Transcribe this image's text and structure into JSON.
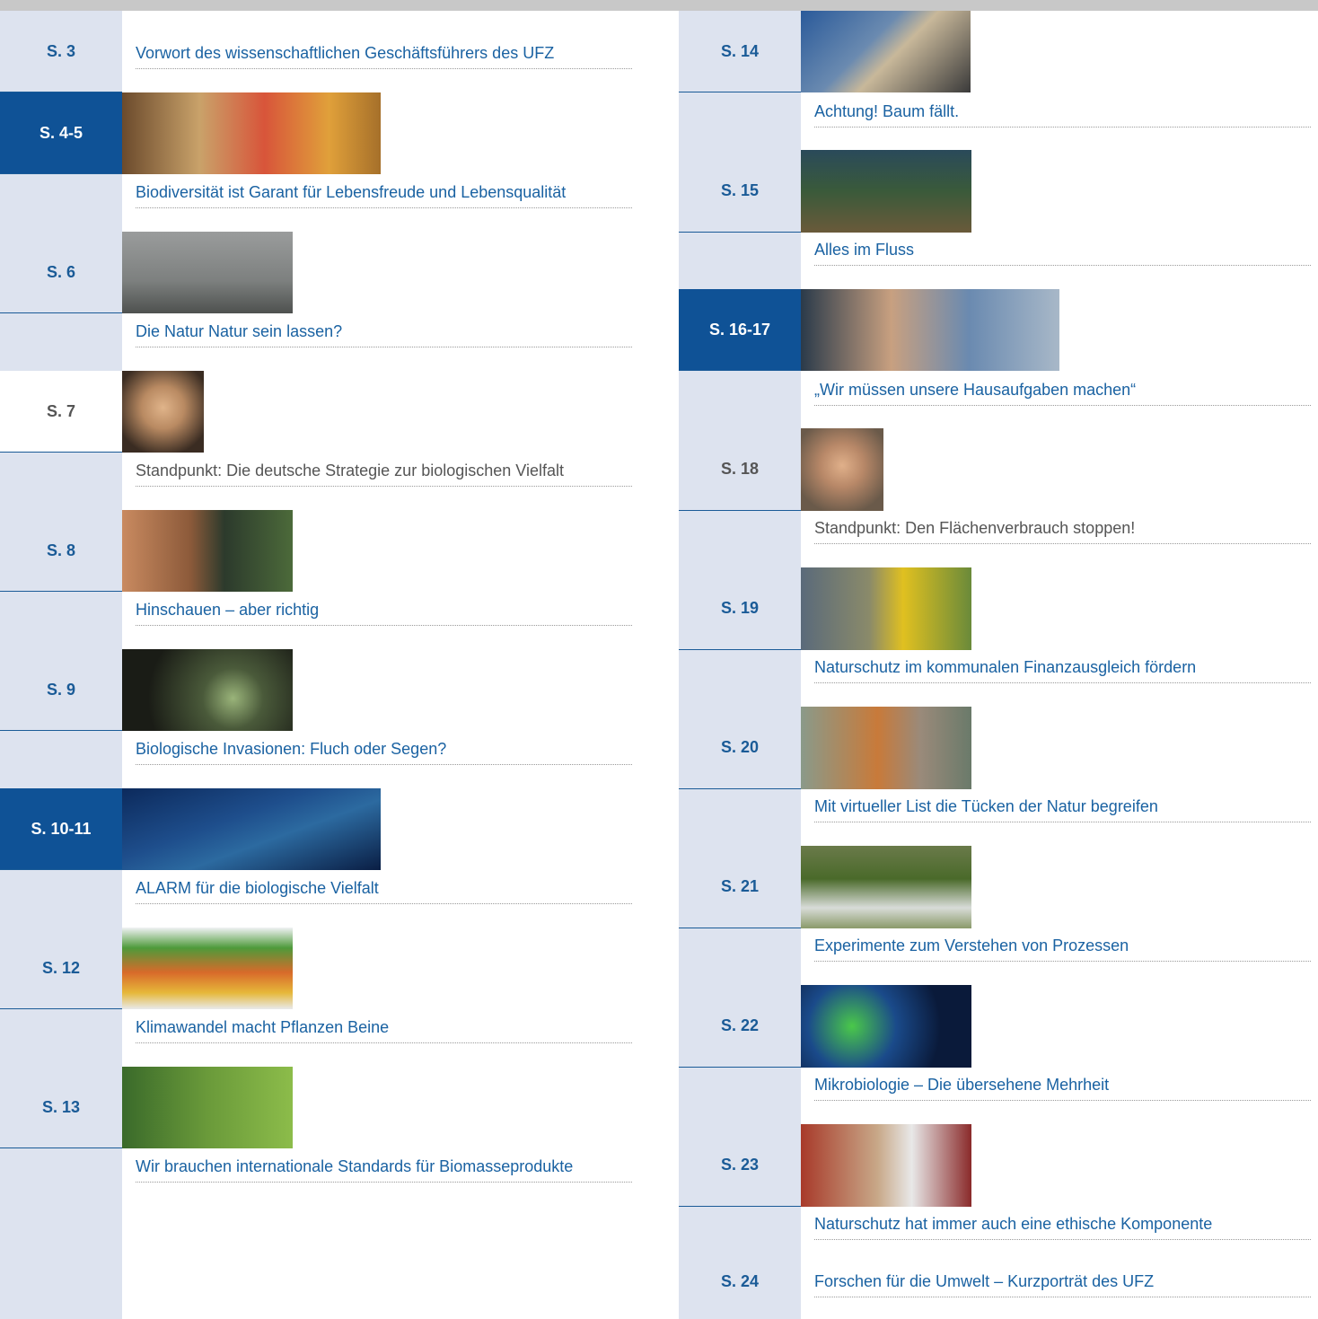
{
  "left": [
    {
      "page": "S. 3",
      "title": "Vorwort des wissenschaftlichen Geschäftsführers des UFZ"
    },
    {
      "page": "S. 4-5",
      "title": "Biodiversität ist Garant für Lebensfreude und Lebensqualität"
    },
    {
      "page": "S. 6",
      "title": "Die Natur Natur sein lassen?"
    },
    {
      "page": "S. 7",
      "title": "Standpunkt: Die deutsche Strategie zur biologischen Vielfalt"
    },
    {
      "page": "S. 8",
      "title": "Hinschauen – aber richtig"
    },
    {
      "page": "S. 9",
      "title": "Biologische Invasionen: Fluch oder Segen?"
    },
    {
      "page": "S. 10-11",
      "title": "ALARM für die biologische Vielfalt"
    },
    {
      "page": "S. 12",
      "title": "Klimawandel macht Pflanzen Beine"
    },
    {
      "page": "S. 13",
      "title": "Wir brauchen internationale Standards für Biomasseprodukte"
    }
  ],
  "right": [
    {
      "page": "S. 14",
      "title": "Achtung! Baum fällt."
    },
    {
      "page": "S. 15",
      "title": "Alles im Fluss"
    },
    {
      "page": "S. 16-17",
      "title": "„Wir müssen unsere Hausaufgaben machen“"
    },
    {
      "page": "S. 18",
      "title": "Standpunkt: Den Flächenverbrauch stoppen!"
    },
    {
      "page": "S. 19",
      "title": "Naturschutz im kommunalen Finanzausgleich fördern"
    },
    {
      "page": "S. 20",
      "title": "Mit virtueller List die Tücken der Natur begreifen"
    },
    {
      "page": "S. 21",
      "title": "Experimente zum Verstehen von Prozessen"
    },
    {
      "page": "S. 22",
      "title": "Mikrobiologie – Die übersehene Mehrheit"
    },
    {
      "page": "S. 23",
      "title": "Naturschutz hat immer auch eine ethische Komponente"
    },
    {
      "page": "S. 24",
      "title": "Forschen für die Umwelt – Kurzporträt des UFZ"
    }
  ],
  "colors": {
    "accent": "#0f5296",
    "side": "#dde3ef",
    "link": "#1a62a2",
    "text_gray": "#555555"
  }
}
